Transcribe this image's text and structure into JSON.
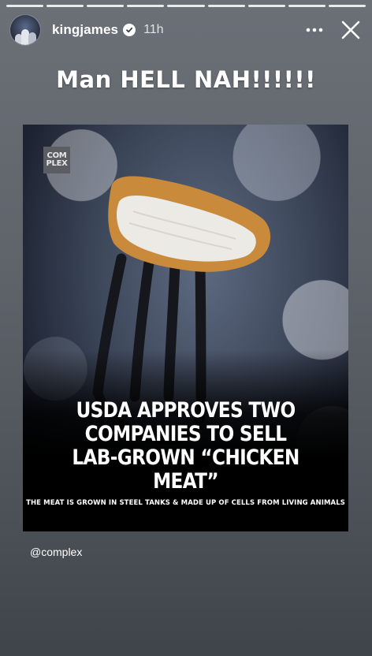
{
  "story": {
    "segments_total": 9,
    "segments_active": 9
  },
  "header": {
    "username": "kingjames",
    "timestamp": "11h",
    "more_icon": "more-horizontal-icon",
    "close_icon": "close-icon",
    "verified_icon": "verified-badge-icon"
  },
  "caption": "Man HELL NAH!!!!!!",
  "post": {
    "logo_line1": "COM",
    "logo_line2": "PLEX",
    "headline_line1": "USDA APPROVES TWO",
    "headline_line2": "COMPANIES TO SELL",
    "headline_line3": "LAB-GROWN “CHICKEN MEAT”",
    "subhead": "THE MEAT IS GROWN IN STEEL TANKS & MADE UP OF CELLS FROM LIVING ANIMALS"
  },
  "mention": "@complex",
  "colors": {
    "background": "#5f646b",
    "verified_check": "#3a3f47",
    "nugget_crust": "#c98a3c",
    "fork": "#15171c"
  }
}
